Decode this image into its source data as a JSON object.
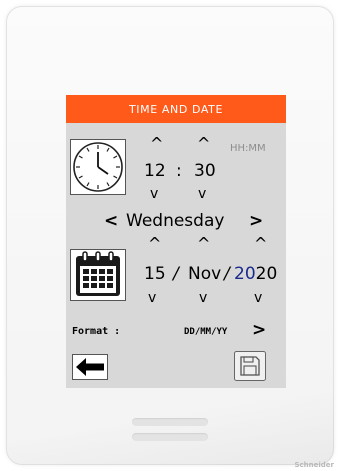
{
  "screen": {
    "title": "TIME AND DATE",
    "colors": {
      "title_bg": "#ff5a1a",
      "screen_bg": "#d8d8d8",
      "year_accent": "#1a2a8c"
    }
  },
  "time": {
    "hour": "12",
    "separator": ":",
    "minute": "30",
    "format_hint": "HH:MM",
    "up_glyph": "^",
    "down_glyph": "v"
  },
  "day": {
    "name": "Wednesday",
    "prev_glyph": "<",
    "next_glyph": ">"
  },
  "date": {
    "day": "15",
    "sep1": "/",
    "month": "Nov",
    "sep2": "/",
    "year_prefix": "20",
    "year_suffix": "20"
  },
  "format": {
    "label": "Format :",
    "value": "DD/MM/YY",
    "next_glyph": ">"
  },
  "icons": {
    "clock": "clock-icon",
    "calendar": "calendar-icon",
    "back": "arrow-left-icon",
    "save": "floppy-disk-icon"
  },
  "device": {
    "brand": "Schneider"
  }
}
